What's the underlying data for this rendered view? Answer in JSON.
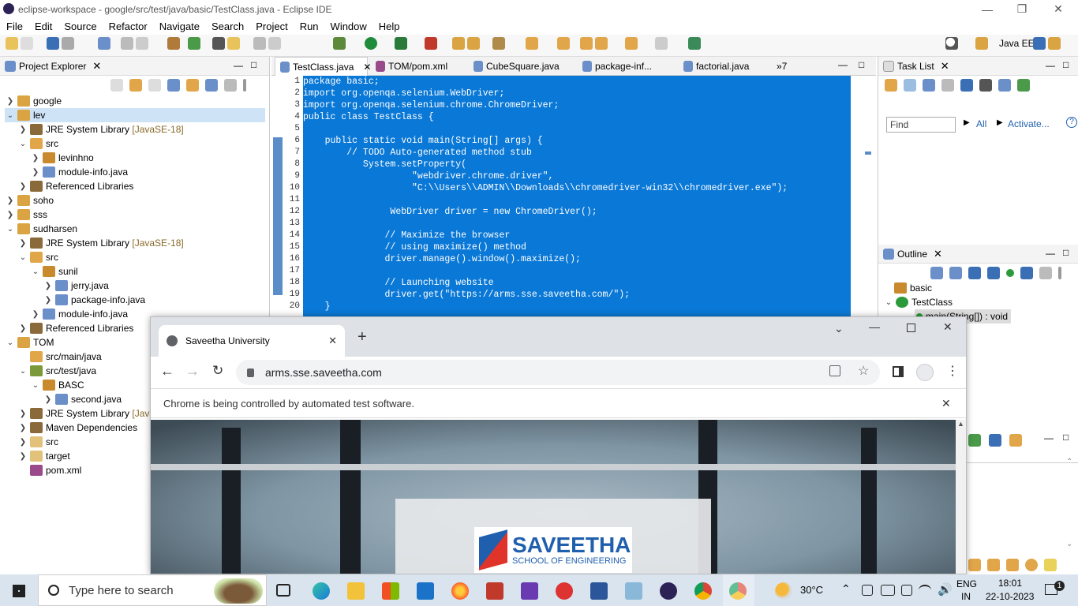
{
  "eclipse": {
    "title": "eclipse-workspace - google/src/test/java/basic/TestClass.java - Eclipse IDE",
    "menu": [
      "File",
      "Edit",
      "Source",
      "Refactor",
      "Navigate",
      "Search",
      "Project",
      "Run",
      "Window",
      "Help"
    ],
    "perspective": "Java EE"
  },
  "project_explorer": {
    "title": "Project Explorer",
    "items": [
      {
        "label": "google",
        "suffix": ""
      },
      {
        "label": "lev",
        "suffix": ""
      },
      {
        "label": "JRE System Library",
        "suffix": "[JavaSE-18]"
      },
      {
        "label": "src",
        "suffix": ""
      },
      {
        "label": "levinhno",
        "suffix": ""
      },
      {
        "label": "module-info.java",
        "suffix": ""
      },
      {
        "label": "Referenced Libraries",
        "suffix": ""
      },
      {
        "label": "soho",
        "suffix": ""
      },
      {
        "label": "sss",
        "suffix": ""
      },
      {
        "label": "sudharsen",
        "suffix": ""
      },
      {
        "label": "JRE System Library",
        "suffix": "[JavaSE-18]"
      },
      {
        "label": "src",
        "suffix": ""
      },
      {
        "label": "sunil",
        "suffix": ""
      },
      {
        "label": "jerry.java",
        "suffix": ""
      },
      {
        "label": "package-info.java",
        "suffix": ""
      },
      {
        "label": "module-info.java",
        "suffix": ""
      },
      {
        "label": "Referenced Libraries",
        "suffix": ""
      },
      {
        "label": "TOM",
        "suffix": ""
      },
      {
        "label": "src/main/java",
        "suffix": ""
      },
      {
        "label": "src/test/java",
        "suffix": ""
      },
      {
        "label": "BASC",
        "suffix": ""
      },
      {
        "label": "second.java",
        "suffix": ""
      },
      {
        "label": "JRE System Library",
        "suffix": "[JavaS"
      },
      {
        "label": "Maven Dependencies",
        "suffix": ""
      },
      {
        "label": "src",
        "suffix": ""
      },
      {
        "label": "target",
        "suffix": ""
      },
      {
        "label": "pom.xml",
        "suffix": ""
      }
    ]
  },
  "editor": {
    "tabs": [
      "TestClass.java",
      "TOM/pom.xml",
      "CubeSquare.java",
      "package-inf...",
      "factorial.java"
    ],
    "overflow": "»7",
    "line_numbers": [
      "1",
      "2",
      "3",
      "4",
      "5",
      "6",
      "7",
      "8",
      "9",
      "10",
      "11",
      "12",
      "13",
      "14",
      "15",
      "16",
      "17",
      "18",
      "19",
      "20"
    ],
    "lines": [
      "package basic;",
      "import org.openqa.selenium.WebDriver;",
      "import org.openqa.selenium.chrome.ChromeDriver;",
      "public class TestClass {",
      "",
      "    public static void main(String[] args) {",
      "        // TODO Auto-generated method stub",
      "           System.setProperty(",
      "                    \"webdriver.chrome.driver\",",
      "                    \"C:\\\\Users\\\\ADMIN\\\\Downloads\\\\chromedriver-win32\\\\chromedriver.exe\");",
      "",
      "                WebDriver driver = new ChromeDriver();",
      "",
      "               // Maximize the browser",
      "               // using maximize() method",
      "               driver.manage().window().maximize();",
      "",
      "               // Launching website",
      "               driver.get(\"https://arms.sse.saveetha.com/\");",
      "    }"
    ]
  },
  "task_list": {
    "title": "Task List",
    "find_placeholder": "Find",
    "all": "All",
    "activate": "Activate..."
  },
  "outline": {
    "title": "Outline",
    "items": [
      "basic",
      "TestClass",
      "main(String[]) : void"
    ]
  },
  "chrome": {
    "tab_title": "Saveetha University",
    "url": "arms.sse.saveetha.com",
    "infobar": "Chrome is being controlled by automated test software.",
    "logo_name": "SAVEETHA",
    "logo_sub": "SCHOOL OF ENGINEERING"
  },
  "taskbar": {
    "search_placeholder": "Type here to search",
    "weather": "30°C",
    "lang1": "ENG",
    "lang2": "IN",
    "time": "18:01",
    "date": "22-10-2023",
    "notifications": "1"
  }
}
